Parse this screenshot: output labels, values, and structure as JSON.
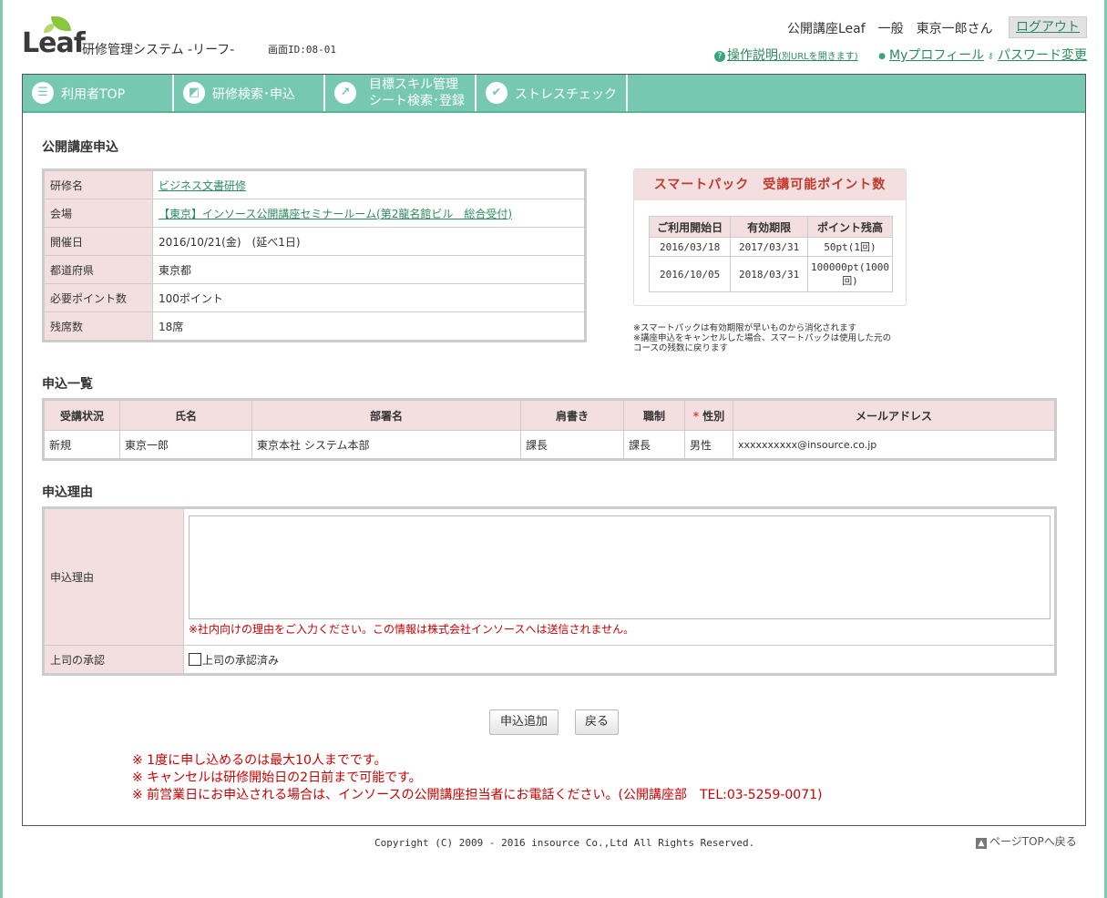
{
  "header": {
    "logo_text": "Leaf",
    "system_name": "研修管理システム -リーフ-",
    "screen_id": "画面ID:08-01",
    "user_info": "公開講座Leaf　一般　東京一郎さん",
    "logout": "ログアウト",
    "links": {
      "help": "操作説明",
      "help_note": "(別URLを開きます)",
      "profile": "Myプロフィール",
      "password": "パスワード変更"
    }
  },
  "nav": {
    "tabs": [
      {
        "label": "利用者TOP",
        "icon": "list-icon"
      },
      {
        "label": "研修検索･申込",
        "icon": "search-document-icon"
      },
      {
        "label_line1": "目標スキル管理",
        "label_line2": "シート検索･登録",
        "icon": "chart-icon"
      },
      {
        "label": "ストレスチェック",
        "icon": "check-icon"
      }
    ]
  },
  "course": {
    "section_title": "公開講座申込",
    "rows": [
      {
        "label": "研修名",
        "value": "ビジネス文書研修"
      },
      {
        "label": "会場",
        "value": "【東京】インソース公開講座セミナールーム(第2龍名館ビル　総合受付)"
      },
      {
        "label": "開催日",
        "value": "2016/10/21(金)　(延べ1日)"
      },
      {
        "label": "都道府県",
        "value": "東京都"
      },
      {
        "label": "必要ポイント数",
        "value": "100ポイント"
      },
      {
        "label": "残席数",
        "value": "18席"
      }
    ]
  },
  "smart_pack": {
    "title": "スマートパック　受講可能ポイント数",
    "headers": [
      "ご利用開始日",
      "有効期限",
      "ポイント残高"
    ],
    "rows": [
      [
        "2016/03/18",
        "2017/03/31",
        "50pt(1回)"
      ],
      [
        "2016/10/05",
        "2018/03/31",
        "100000pt(1000回)"
      ]
    ],
    "note1": "※スマートパックは有効期限が早いものから消化されます",
    "note2": "※講座申込をキャンセルした場合、スマートパックは使用した元のコースの残数に戻ります"
  },
  "applicants": {
    "section_title": "申込一覧",
    "headers": [
      "受講状況",
      "氏名",
      "部署名",
      "肩書き",
      "職制",
      "性別",
      "メールアドレス"
    ],
    "required_mark": "*",
    "rows": [
      [
        "新規",
        "東京一郎",
        "東京本社 システム本部",
        "課長",
        "課長",
        "男性",
        "xxxxxxxxxx@insource.co.jp"
      ]
    ]
  },
  "reason": {
    "section_title": "申込理由",
    "label": "申込理由",
    "value": "",
    "note": "※社内向けの理由をご入力ください。この情報は株式会社インソースへは送信されません。",
    "approval_label": "上司の承認",
    "approval_checkbox": "上司の承認済み"
  },
  "buttons": {
    "add": "申込追加",
    "back": "戻る"
  },
  "notes": [
    "※ 1度に申し込めるのは最大10人までです。",
    "※ キャンセルは研修開始日の2日前まで可能です。",
    "※ 前営業日にお申込される場合は、インソースの公開講座担当者にお電話ください。(公開講座部　TEL:03-5259-0071)"
  ],
  "footer": {
    "copyright": "Copyright (C) 2009 - 2016 insource Co.,Ltd All Rights Reserved.",
    "page_top": "ページTOPへ戻る"
  }
}
